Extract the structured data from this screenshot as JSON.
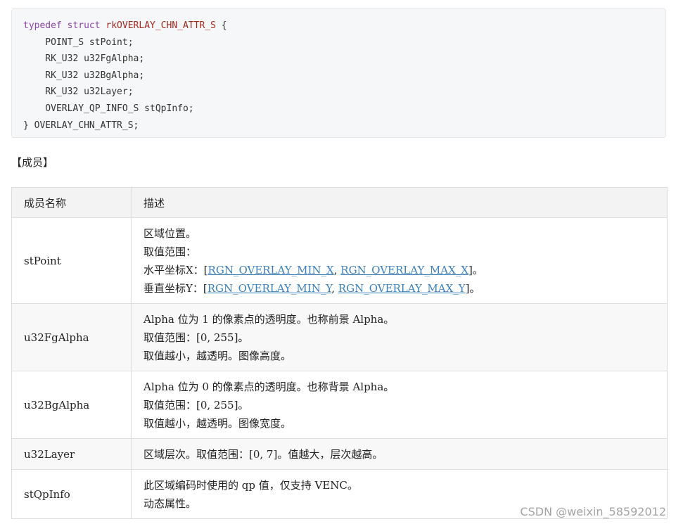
{
  "code": {
    "lines": [
      {
        "kw": "typedef struct",
        "ty": "rkOVERLAY_CHN_ATTR_S",
        "rest": " {"
      },
      {
        "text": "    POINT_S stPoint;"
      },
      {
        "text": "    RK_U32 u32FgAlpha;"
      },
      {
        "text": "    RK_U32 u32BgAlpha;"
      },
      {
        "text": "    RK_U32 u32Layer;"
      },
      {
        "text": "    OVERLAY_QP_INFO_S stQpInfo;"
      },
      {
        "text": "} OVERLAY_CHN_ATTR_S;"
      }
    ]
  },
  "section": {
    "title": "【成员】"
  },
  "table": {
    "headers": [
      "成员名称",
      "描述"
    ],
    "rows": [
      {
        "name": "stPoint",
        "lines": [
          {
            "text": "区域位置。"
          },
          {
            "text": "取值范围："
          },
          {
            "prefix": "水平坐标X：[",
            "link1": "RGN_OVERLAY_MIN_X",
            "sep": ", ",
            "link2": "RGN_OVERLAY_MAX_X",
            "suffix": "]。"
          },
          {
            "prefix": "垂直坐标Y：[",
            "link1": "RGN_OVERLAY_MIN_Y",
            "sep": ", ",
            "link2": "RGN_OVERLAY_MAX_Y",
            "suffix": "]。"
          }
        ]
      },
      {
        "name": "u32FgAlpha",
        "lines": [
          {
            "text": "Alpha 位为 1 的像素点的透明度。也称前景 Alpha。"
          },
          {
            "text": "取值范围：[0, 255]。"
          },
          {
            "text": "取值越小，越透明。图像高度。"
          }
        ]
      },
      {
        "name": "u32BgAlpha",
        "lines": [
          {
            "text": "Alpha 位为 0 的像素点的透明度。也称背景 Alpha。"
          },
          {
            "text": "取值范围：[0, 255]。"
          },
          {
            "text": "取值越小，越透明。图像宽度。"
          }
        ]
      },
      {
        "name": "u32Layer",
        "lines": [
          {
            "text": "区域层次。取值范围：[0, 7]。值越大，层次越高。"
          }
        ]
      },
      {
        "name": "stQpInfo",
        "lines": [
          {
            "text": "此区域编码时使用的 qp 值，仅支持 VENC。"
          },
          {
            "text": "动态属性。"
          }
        ]
      }
    ]
  },
  "watermark": "CSDN @weixin_58592012"
}
